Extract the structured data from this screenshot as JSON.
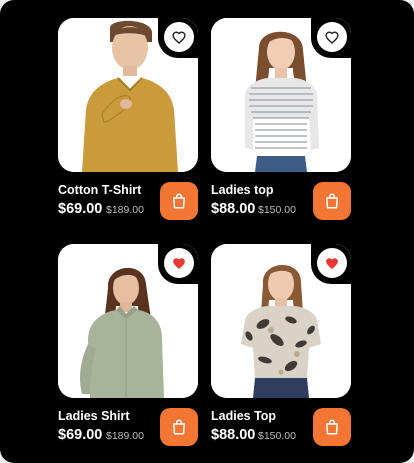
{
  "colors": {
    "accent": "#f47634",
    "favorite_active": "#e53935",
    "background": "#000000"
  },
  "products": [
    {
      "name": "Cotton T-Shirt",
      "price": "$69.00",
      "old_price": "$189.00",
      "favorited": false,
      "heart_icon": "heart-outline-icon",
      "cart_icon": "shopping-bag-icon"
    },
    {
      "name": "Ladies top",
      "price": "$88.00",
      "old_price": "$150.00",
      "favorited": false,
      "heart_icon": "heart-outline-icon",
      "cart_icon": "shopping-bag-icon"
    },
    {
      "name": "Ladies Shirt",
      "price": "$69.00",
      "old_price": "$189.00",
      "favorited": true,
      "heart_icon": "heart-filled-icon",
      "cart_icon": "shopping-bag-icon"
    },
    {
      "name": "Ladies Top",
      "price": "$88.00",
      "old_price": "$150.00",
      "favorited": true,
      "heart_icon": "heart-filled-icon",
      "cart_icon": "shopping-bag-icon"
    }
  ]
}
